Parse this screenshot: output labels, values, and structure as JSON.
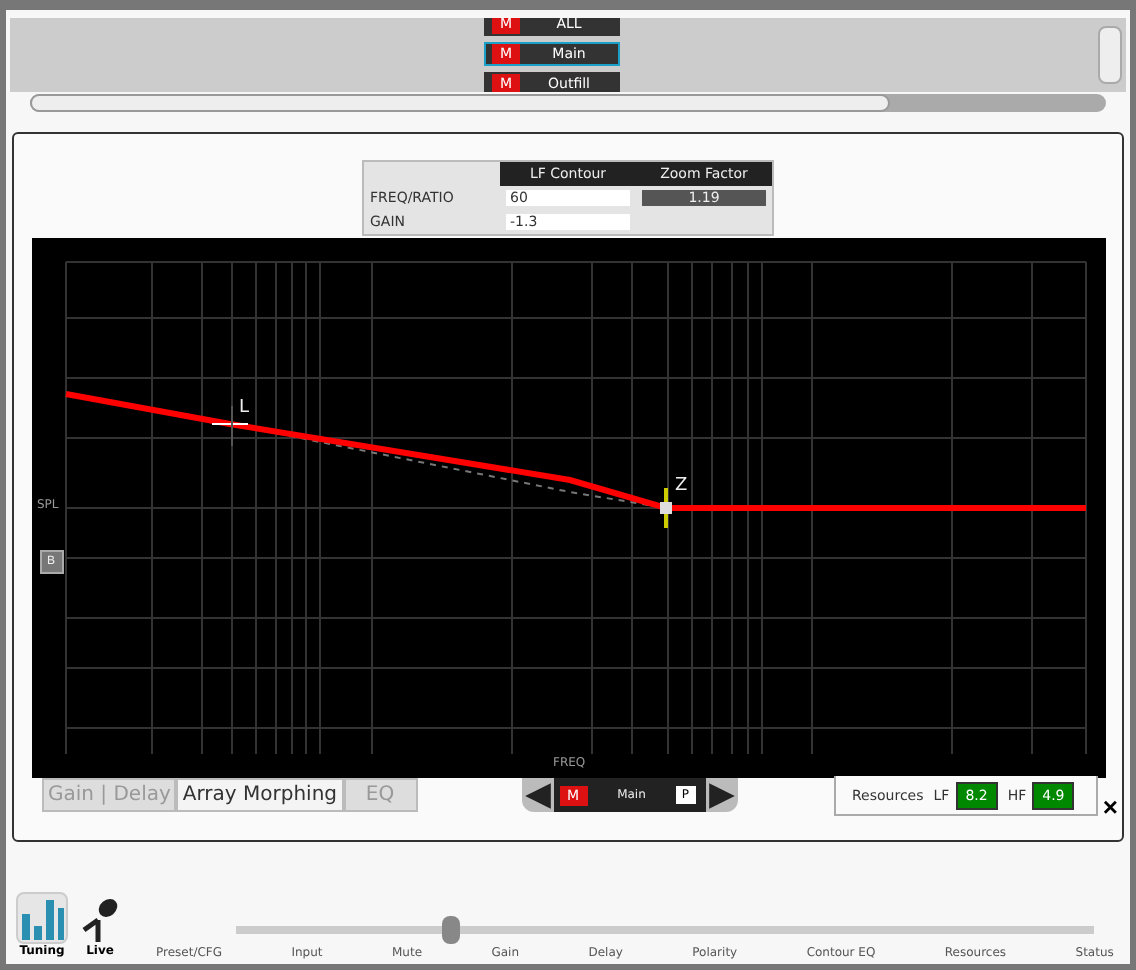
{
  "zone_list": [
    {
      "label": "ALL",
      "mute": "M",
      "selected": false
    },
    {
      "label": "Main",
      "mute": "M",
      "selected": true
    },
    {
      "label": "Outfill",
      "mute": "M",
      "selected": false
    }
  ],
  "eq_table": {
    "columns": [
      "LF Contour",
      "Zoom Factor"
    ],
    "rows": [
      {
        "label": "FREQ/RATIO",
        "value": "60",
        "zoom": "1.19"
      },
      {
        "label": "GAIN",
        "value": "-1.3"
      }
    ]
  },
  "graph": {
    "ylabel": "SPL",
    "xlabel": "FREQ",
    "side_button": "B",
    "markers": [
      "L",
      "Z"
    ]
  },
  "tabs": [
    {
      "label": "Gain | Delay",
      "selected": false
    },
    {
      "label": "Array Morphing",
      "selected": true
    },
    {
      "label": "EQ",
      "selected": false
    }
  ],
  "zone_selector": {
    "mute": "M",
    "name": "Main",
    "polarity": "P"
  },
  "resources": {
    "label": "Resources",
    "items": [
      {
        "label": "LF",
        "value": "8.2"
      },
      {
        "label": "HF",
        "value": "4.9"
      }
    ]
  },
  "close": "×",
  "nav_modes": [
    {
      "label": "Tuning",
      "selected": true,
      "kind": "bars"
    },
    {
      "label": "Live",
      "selected": false,
      "kind": "mic"
    }
  ],
  "steps": {
    "level": 0.25,
    "labels": [
      "Preset/CFG",
      "Input",
      "Mute",
      "Gain",
      "Delay",
      "Polarity",
      "Contour EQ",
      "Resources",
      "Status"
    ]
  }
}
